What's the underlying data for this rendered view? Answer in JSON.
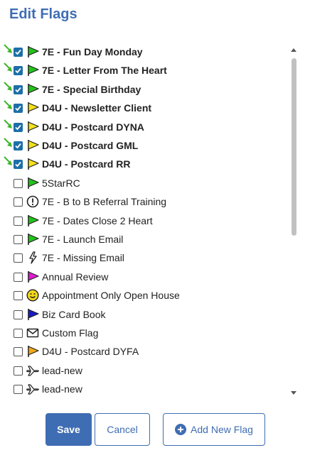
{
  "dialog": {
    "title": "Edit Flags",
    "save_label": "Save",
    "cancel_label": "Cancel",
    "add_label": "Add New Flag"
  },
  "flags": [
    {
      "label": "7E - Fun Day Monday",
      "checked": true,
      "bold": true,
      "icon": "flag",
      "color": "#22c41a",
      "arrow": true
    },
    {
      "label": "7E - Letter From The Heart",
      "checked": true,
      "bold": true,
      "icon": "flag",
      "color": "#22c41a",
      "arrow": true
    },
    {
      "label": "7E - Special Birthday",
      "checked": true,
      "bold": true,
      "icon": "flag",
      "color": "#22c41a",
      "arrow": true
    },
    {
      "label": "D4U - Newsletter Client",
      "checked": true,
      "bold": true,
      "icon": "flag",
      "color": "#f2e21a",
      "arrow": true
    },
    {
      "label": "D4U - Postcard DYNA",
      "checked": true,
      "bold": true,
      "icon": "flag",
      "color": "#f2e21a",
      "arrow": true
    },
    {
      "label": "D4U - Postcard GML",
      "checked": true,
      "bold": true,
      "icon": "flag",
      "color": "#f2e21a",
      "arrow": true
    },
    {
      "label": "D4U - Postcard RR",
      "checked": true,
      "bold": true,
      "icon": "flag",
      "color": "#f2e21a",
      "arrow": true
    },
    {
      "label": "5StarRC",
      "checked": false,
      "bold": false,
      "icon": "flag",
      "color": "#22c41a",
      "arrow": false
    },
    {
      "label": "7E - B to B Referral Training",
      "checked": false,
      "bold": false,
      "icon": "exclamation-circle",
      "color": "#222222",
      "arrow": false
    },
    {
      "label": "7E - Dates Close 2 Heart",
      "checked": false,
      "bold": false,
      "icon": "flag",
      "color": "#22c41a",
      "arrow": false
    },
    {
      "label": "7E - Launch Email",
      "checked": false,
      "bold": false,
      "icon": "flag",
      "color": "#22c41a",
      "arrow": false
    },
    {
      "label": "7E - Missing Email",
      "checked": false,
      "bold": false,
      "icon": "lightning-bolt",
      "color": "#222222",
      "arrow": false
    },
    {
      "label": "Annual Review",
      "checked": false,
      "bold": false,
      "icon": "flag",
      "color": "#e21ad2",
      "arrow": false
    },
    {
      "label": "Appointment Only Open House",
      "checked": false,
      "bold": false,
      "icon": "smiley",
      "color": "#f2d61a",
      "arrow": false
    },
    {
      "label": "Biz Card Book",
      "checked": false,
      "bold": false,
      "icon": "flag",
      "color": "#1a1ac8",
      "arrow": false
    },
    {
      "label": "Custom Flag",
      "checked": false,
      "bold": false,
      "icon": "envelope",
      "color": "#222222",
      "arrow": false
    },
    {
      "label": "D4U - Postcard DYFA",
      "checked": false,
      "bold": false,
      "icon": "flag",
      "color": "#f2a81a",
      "arrow": false
    },
    {
      "label": "lead-new",
      "checked": false,
      "bold": false,
      "icon": "airplane",
      "color": "#222222",
      "arrow": false
    },
    {
      "label": "lead-new",
      "checked": false,
      "bold": false,
      "icon": "airplane",
      "color": "#222222",
      "arrow": false
    }
  ]
}
